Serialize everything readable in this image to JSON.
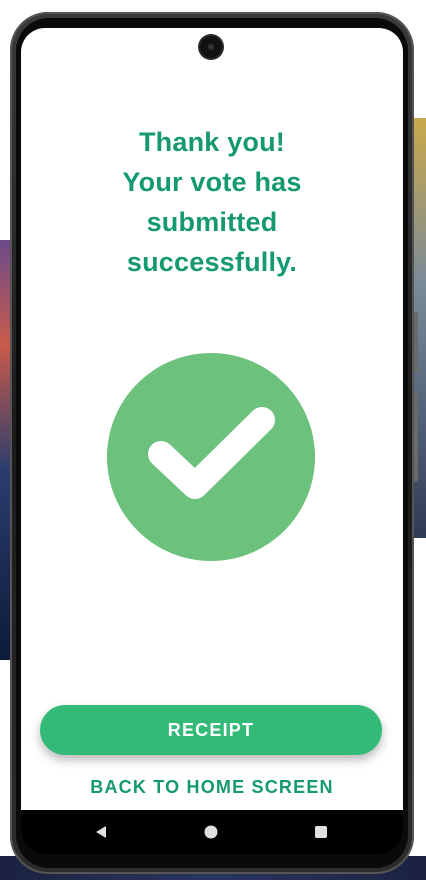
{
  "message": {
    "line1": "Thank you!",
    "line2": "Your vote has",
    "line3": "submitted",
    "line4": "successfully."
  },
  "status_icon": "check-circle-icon",
  "actions": {
    "receipt_label": "RECEIPT",
    "home_label": "BACK TO HOME SCREEN"
  },
  "navigation": {
    "back_icon": "back-triangle-icon",
    "home_icon": "home-circle-icon",
    "recents_icon": "recents-square-icon"
  },
  "colors": {
    "accent_text": "#149970",
    "button": "#33b978",
    "success_circle": "#6cc17c"
  }
}
